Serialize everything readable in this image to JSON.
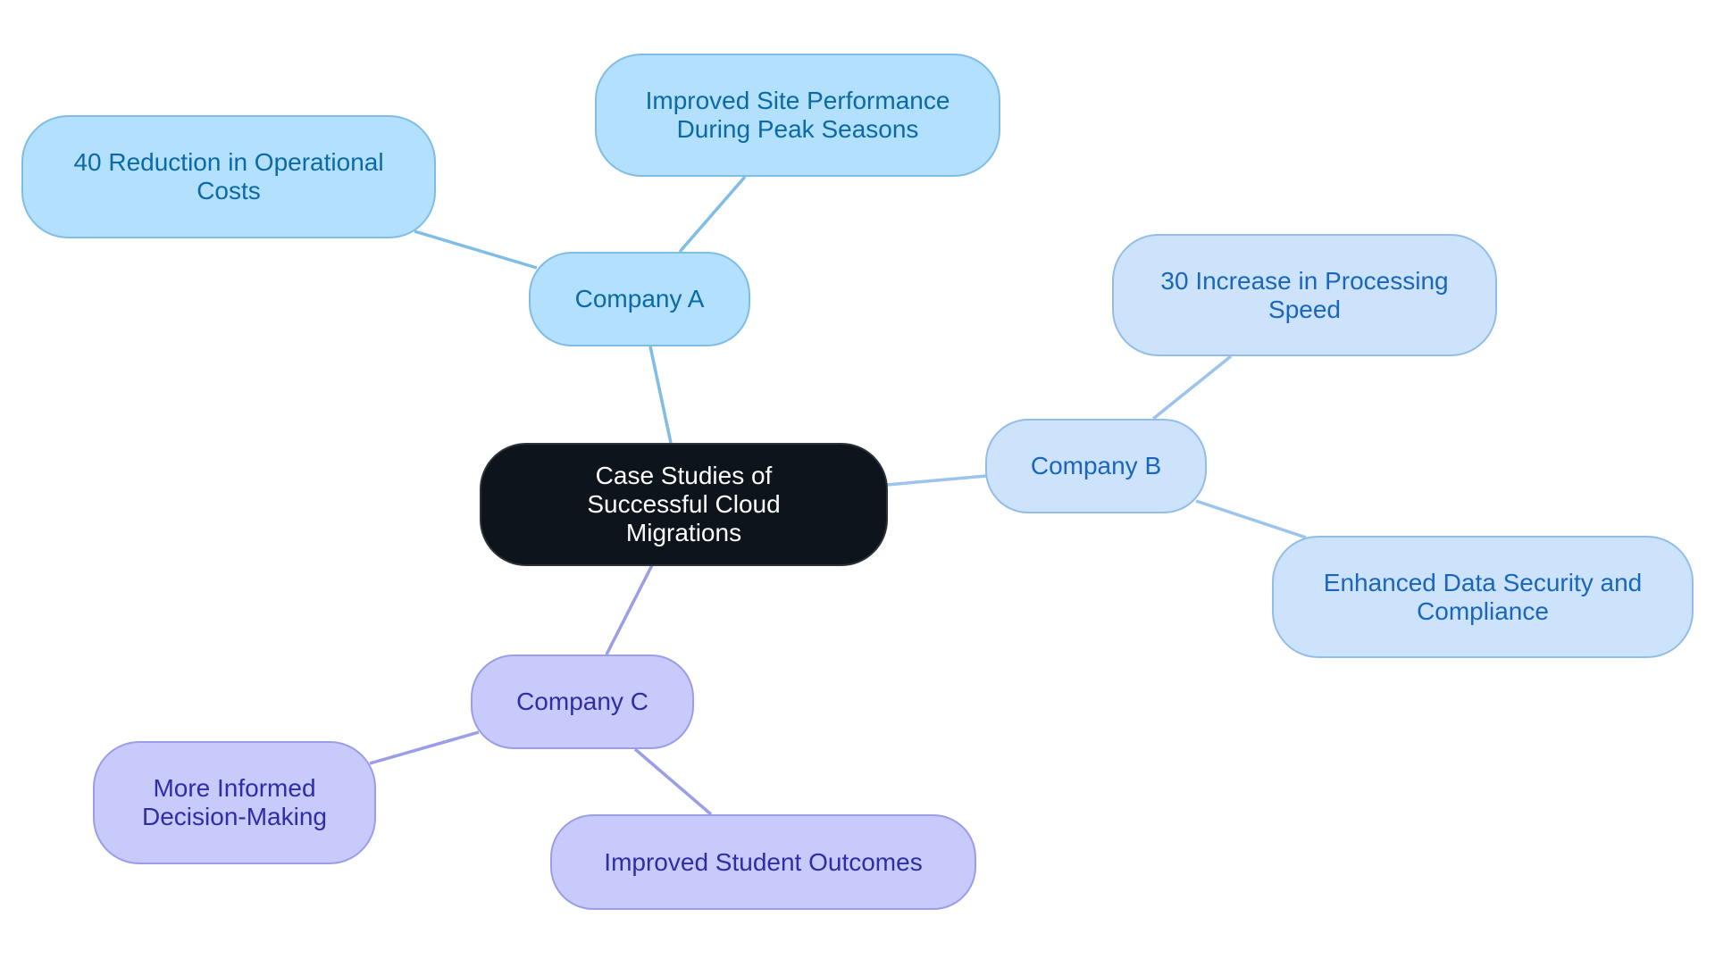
{
  "diagram": {
    "type": "mind-map",
    "root": {
      "label": "Case Studies of Successful Cloud Migrations"
    },
    "branches": [
      {
        "label": "Company A",
        "color": {
          "fill": "#b3e0fc",
          "stroke": "#7fbde6",
          "text": "#0b6aa6",
          "edge": "#7fbde6"
        },
        "children": [
          {
            "label": "Improved Site Performance During Peak Seasons"
          },
          {
            "label": "40 Reduction in Operational Costs"
          }
        ]
      },
      {
        "label": "Company B",
        "color": {
          "fill": "#cde3fb",
          "stroke": "#93bde9",
          "text": "#1966be",
          "edge": "#9cc3ec"
        },
        "children": [
          {
            "label": "30 Increase in Processing Speed"
          },
          {
            "label": "Enhanced Data Security and Compliance"
          }
        ]
      },
      {
        "label": "Company C",
        "color": {
          "fill": "#c8cafc",
          "stroke": "#9a9de8",
          "text": "#2e2da6",
          "edge": "#9a9de8"
        },
        "children": [
          {
            "label": "More Informed Decision-Making"
          },
          {
            "label": "Improved Student Outcomes"
          }
        ]
      }
    ]
  }
}
